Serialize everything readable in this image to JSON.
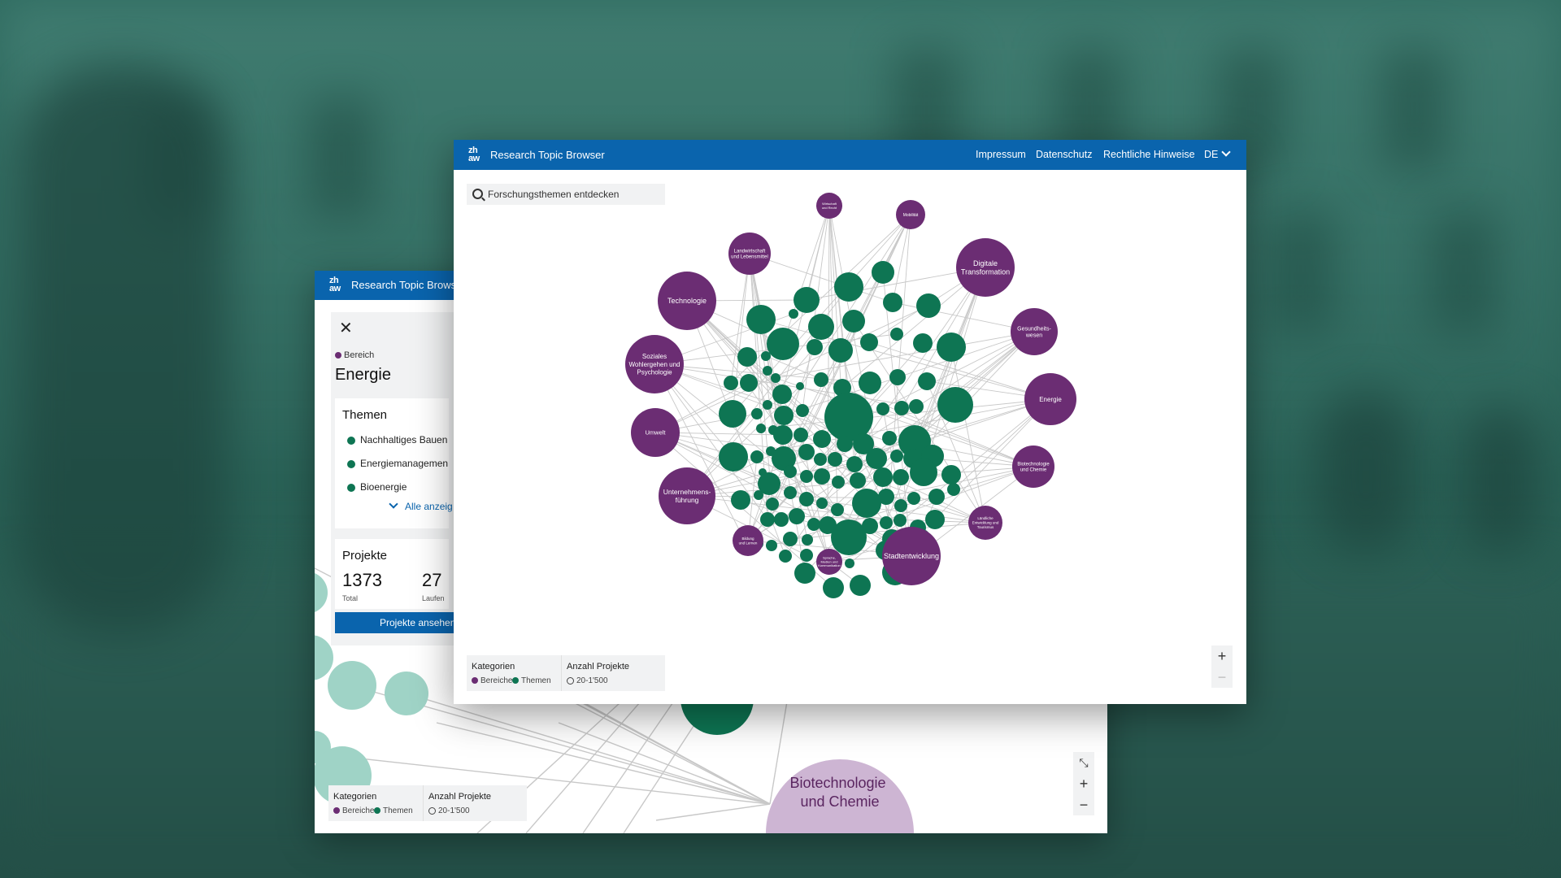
{
  "back_window": {
    "app_title": "Research Topic Brows",
    "logo_text": "zh aw",
    "panel": {
      "close_label": "✕",
      "category_label": "Bereich",
      "area_title": "Energie",
      "themes_title": "Themen",
      "themes": [
        "Nachhaltiges Bauen",
        "Energiemanagemen",
        "Bioenergie"
      ],
      "show_all_label": "Alle anzeig",
      "projects_title": "Projekte",
      "total_value": "1373",
      "total_label": "Total",
      "running_value": "27",
      "running_label": "Laufen",
      "view_projects_button": "Projekte ansehen"
    },
    "bubble_label": "Biotechnologie und Chemie",
    "bubble_label_lines": [
      "Biotechnologie",
      "und Chemie"
    ],
    "legend": {
      "categories_title": "Kategorien",
      "areas_label": "Bereiche",
      "topics_label": "Themen",
      "count_title": "Anzahl Projekte",
      "count_range": "20-1'500"
    },
    "zoom": {
      "collapse_icon": "collapse-icon",
      "zoom_in": "+",
      "zoom_out": "−"
    }
  },
  "front_window": {
    "app_title": "Research Topic Browser",
    "logo_text": "zh aw",
    "nav": [
      "Impressum",
      "Datenschutz",
      "Rechtliche Hinweise"
    ],
    "language": "DE",
    "search_placeholder": "Forschungsthemen entdecken",
    "legend": {
      "categories_title": "Kategorien",
      "areas_label": "Bereiche",
      "topics_label": "Themen",
      "count_title": "Anzahl Projekte",
      "count_range": "20-1'500"
    },
    "zoom": {
      "zoom_in": "+",
      "zoom_out": "−"
    },
    "areas": [
      {
        "label": [
          "Wirtschaft",
          "und Recht"
        ]
      },
      {
        "label": [
          "Mobilität"
        ]
      },
      {
        "label": [
          "Digitale",
          "Transformation"
        ]
      },
      {
        "label": [
          "Gesundheits-",
          "wesen"
        ]
      },
      {
        "label": [
          "Energie"
        ]
      },
      {
        "label": [
          "Biotechnologie",
          "und Chemie"
        ]
      },
      {
        "label": [
          "Ländliche",
          "Entwicklung und",
          "Tourismus"
        ]
      },
      {
        "label": [
          "Stadtentwicklung"
        ]
      },
      {
        "label": [
          "Sprache,",
          "Medien und",
          "Kommunikation"
        ]
      },
      {
        "label": [
          "Bildung",
          "und Lernen"
        ]
      },
      {
        "label": [
          "Unternehmens-",
          "führung"
        ]
      },
      {
        "label": [
          "Umwelt"
        ]
      },
      {
        "label": [
          "Soziales",
          "Wohlergehen und",
          "Psychologie"
        ]
      },
      {
        "label": [
          "Technologie"
        ]
      },
      {
        "label": [
          "Landwirtschaft",
          "und Lebensmittel"
        ]
      }
    ]
  },
  "colors": {
    "header_blue": "#0a64ad",
    "area_purple": "#6b2d73",
    "topic_green": "#0e7553",
    "topic_green_light": "#9fd3c6",
    "area_purple_light": "#cdb5d3",
    "edge_gray": "#c8c8c8",
    "background_teal": "#2a6358"
  }
}
